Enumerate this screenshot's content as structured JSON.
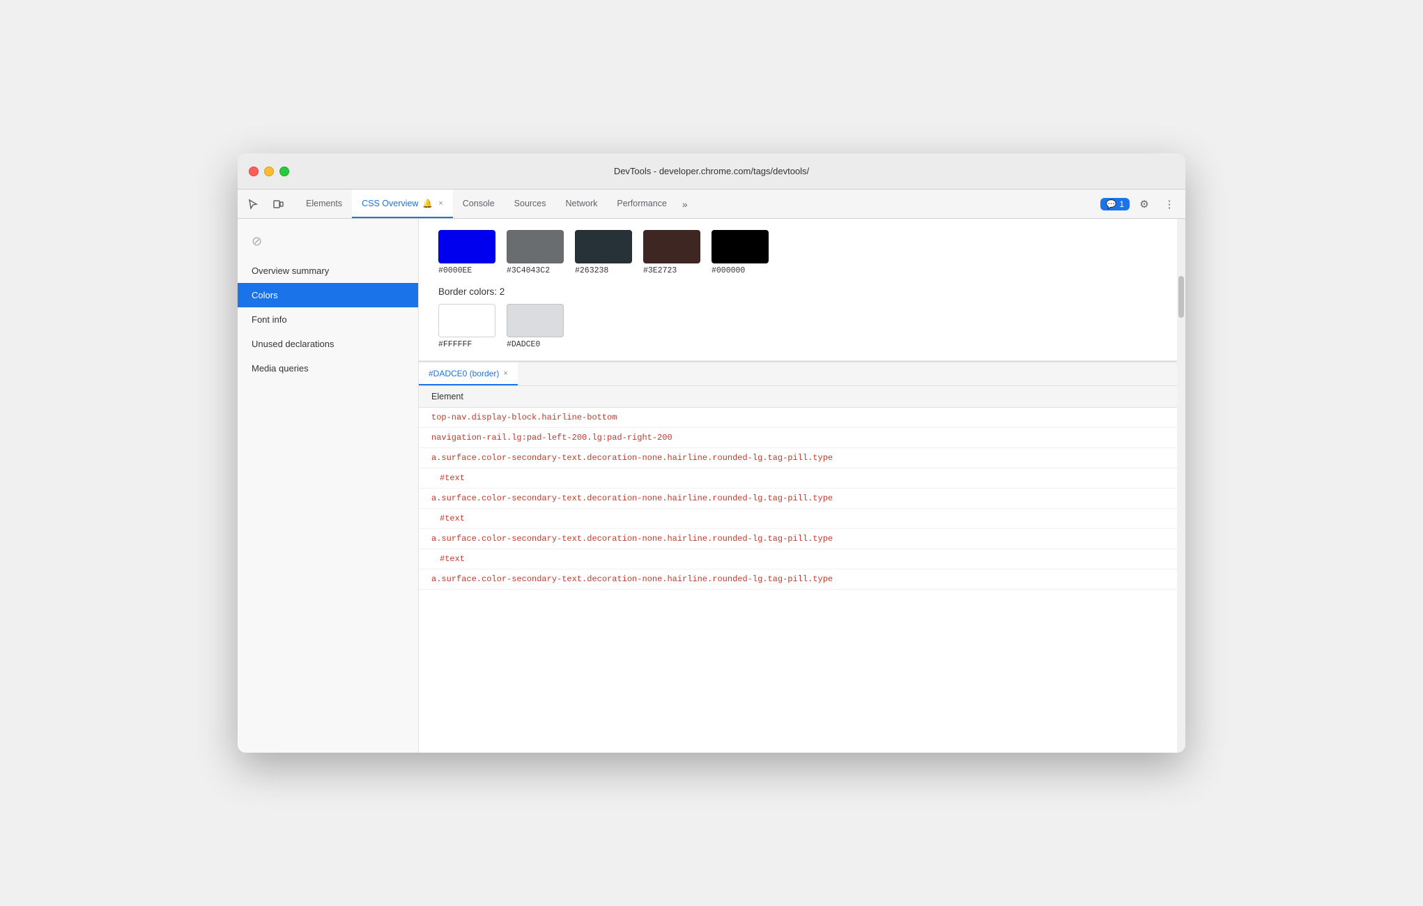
{
  "window": {
    "title": "DevTools - developer.chrome.com/tags/devtools/"
  },
  "tabs": [
    {
      "id": "elements",
      "label": "Elements",
      "active": false,
      "closeable": false
    },
    {
      "id": "css-overview",
      "label": "CSS Overview",
      "active": true,
      "closeable": true,
      "has_icon": true
    },
    {
      "id": "console",
      "label": "Console",
      "active": false,
      "closeable": false
    },
    {
      "id": "sources",
      "label": "Sources",
      "active": false,
      "closeable": false
    },
    {
      "id": "network",
      "label": "Network",
      "active": false,
      "closeable": false
    },
    {
      "id": "performance",
      "label": "Performance",
      "active": false,
      "closeable": false
    }
  ],
  "more_tabs_label": "»",
  "chat_badge": "1",
  "sidebar": {
    "items": [
      {
        "id": "overview-summary",
        "label": "Overview summary",
        "active": false
      },
      {
        "id": "colors",
        "label": "Colors",
        "active": true
      },
      {
        "id": "font-info",
        "label": "Font info",
        "active": false
      },
      {
        "id": "unused-declarations",
        "label": "Unused declarations",
        "active": false
      },
      {
        "id": "media-queries",
        "label": "Media queries",
        "active": false
      }
    ]
  },
  "colors_section": {
    "top_swatches": [
      {
        "color": "#0000EE",
        "label": "#0000EE"
      },
      {
        "color": "#3C4043C2",
        "display_color": "#3C4043",
        "label": "#3C4043C2"
      },
      {
        "color": "#263238",
        "label": "#263238"
      },
      {
        "color": "#3E2723",
        "label": "#3E2723"
      },
      {
        "color": "#000000",
        "label": "#000000"
      }
    ],
    "border_colors_header": "Border colors: 2",
    "border_swatches": [
      {
        "color": "#FFFFFF",
        "label": "#FFFFFF",
        "border": true
      },
      {
        "color": "#DADCE0",
        "label": "#DADCE0",
        "border": true
      }
    ]
  },
  "bottom_panel": {
    "active_tab_label": "#DADCE0 (border)",
    "element_column_header": "Element",
    "rows": [
      {
        "type": "selector",
        "text": "top-nav.display-block.hairline-bottom"
      },
      {
        "type": "selector",
        "text": "navigation-rail.lg:pad-left-200.lg:pad-right-200"
      },
      {
        "type": "selector",
        "text": "a.surface.color-secondary-text.decoration-none.hairline.rounded-lg.tag-pill.type"
      },
      {
        "type": "text",
        "text": "#text"
      },
      {
        "type": "selector",
        "text": "a.surface.color-secondary-text.decoration-none.hairline.rounded-lg.tag-pill.type"
      },
      {
        "type": "text",
        "text": "#text"
      },
      {
        "type": "selector",
        "text": "a.surface.color-secondary-text.decoration-none.hairline.rounded-lg.tag-pill.type"
      },
      {
        "type": "text",
        "text": "#text"
      },
      {
        "type": "selector",
        "text": "a.surface.color-secondary-text.decoration-none.hairline.rounded-lg.tag-pill.type"
      }
    ]
  },
  "icons": {
    "cursor": "⬡",
    "device": "⬜",
    "blocked": "⊘",
    "gear": "⚙",
    "more": "⋮",
    "chat": "💬",
    "close": "×"
  }
}
